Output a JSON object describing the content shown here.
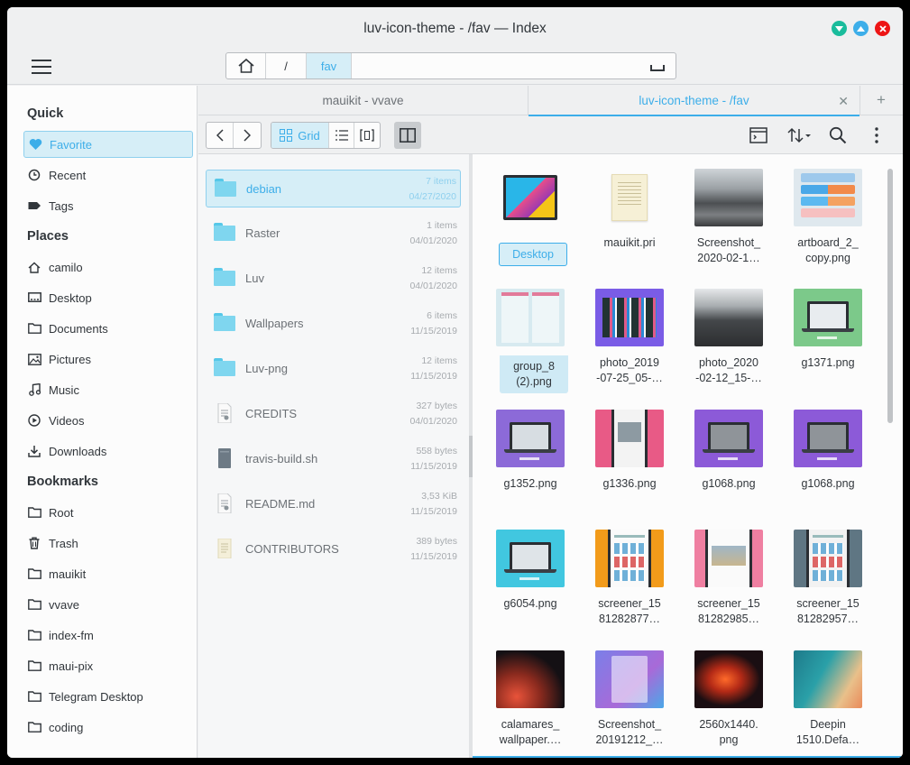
{
  "window": {
    "title": "luv-icon-theme - /fav — Index"
  },
  "pathbar": {
    "segments": [
      "/",
      "fav"
    ]
  },
  "sidebar": {
    "sections": [
      {
        "title": "Quick",
        "items": [
          {
            "label": "Favorite",
            "icon": "heart-icon",
            "active": true
          },
          {
            "label": "Recent",
            "icon": "history-icon"
          },
          {
            "label": "Tags",
            "icon": "tag-icon"
          }
        ]
      },
      {
        "title": "Places",
        "items": [
          {
            "label": "camilo",
            "icon": "home-icon"
          },
          {
            "label": "Desktop",
            "icon": "desktop-icon"
          },
          {
            "label": "Documents",
            "icon": "folder-icon"
          },
          {
            "label": "Pictures",
            "icon": "picture-icon"
          },
          {
            "label": "Music",
            "icon": "music-icon"
          },
          {
            "label": "Videos",
            "icon": "video-icon"
          },
          {
            "label": "Downloads",
            "icon": "download-icon"
          }
        ]
      },
      {
        "title": "Bookmarks",
        "items": [
          {
            "label": "Root",
            "icon": "folder-icon"
          },
          {
            "label": "Trash",
            "icon": "trash-icon"
          },
          {
            "label": "mauikit",
            "icon": "folder-icon"
          },
          {
            "label": "vvave",
            "icon": "folder-icon"
          },
          {
            "label": "index-fm",
            "icon": "folder-icon"
          },
          {
            "label": "maui-pix",
            "icon": "folder-icon"
          },
          {
            "label": "Telegram Desktop",
            "icon": "folder-icon"
          },
          {
            "label": "coding",
            "icon": "folder-icon"
          }
        ]
      }
    ]
  },
  "tabs": [
    {
      "label": "mauikit  -  vvave"
    },
    {
      "label": "luv-icon-theme  -  /fav",
      "active": true
    }
  ],
  "toolbar": {
    "grid_label": "Grid"
  },
  "list": [
    {
      "name": "debian",
      "meta": "7 items",
      "date": "04/27/2020",
      "type": "folder",
      "selected": true
    },
    {
      "name": "Raster",
      "meta": "1 items",
      "date": "04/01/2020",
      "type": "folder"
    },
    {
      "name": "Luv",
      "meta": "12 items",
      "date": "04/01/2020",
      "type": "folder"
    },
    {
      "name": "Wallpapers",
      "meta": "6 items",
      "date": "11/15/2019",
      "type": "folder"
    },
    {
      "name": "Luv-png",
      "meta": "12 items",
      "date": "11/15/2019",
      "type": "folder"
    },
    {
      "name": "CREDITS",
      "meta": "327 bytes",
      "date": "04/01/2020",
      "type": "text"
    },
    {
      "name": "travis-build.sh",
      "meta": "558 bytes",
      "date": "11/15/2019",
      "type": "script"
    },
    {
      "name": "README.md",
      "meta": "3,53 KiB",
      "date": "11/15/2019",
      "type": "text"
    },
    {
      "name": "CONTRIBUTORS",
      "meta": "389 bytes",
      "date": "11/15/2019",
      "type": "doc"
    }
  ],
  "grid": [
    {
      "label": "Desktop",
      "kind": "desktop",
      "style": "box"
    },
    {
      "label": "mauikit.pri",
      "kind": "doc"
    },
    {
      "label": "Screenshot_\n2020-02-1…",
      "kind": "photo-building"
    },
    {
      "label": "artboard_2_\ncopy.png",
      "kind": "app-ui"
    },
    {
      "label": "group_8\n(2).png",
      "kind": "mock-light",
      "style": "block"
    },
    {
      "label": "photo_2019\n-07-25_05-…",
      "kind": "purple-screen"
    },
    {
      "label": "photo_2020\n-02-12_15-…",
      "kind": "photo-river"
    },
    {
      "label": "g1371.png",
      "kind": "green-laptop"
    },
    {
      "label": "g1352.png",
      "kind": "purple-laptop"
    },
    {
      "label": "g1336.png",
      "kind": "pink-phone"
    },
    {
      "label": "g1068.png",
      "kind": "purple-dark-laptop"
    },
    {
      "label": "g1068.png",
      "kind": "purple-dark-laptop"
    },
    {
      "label": "g6054.png",
      "kind": "cyan-laptop"
    },
    {
      "label": "screener_15\n81282877…",
      "kind": "orange-phone"
    },
    {
      "label": "screener_15\n81282985…",
      "kind": "pink-phone2"
    },
    {
      "label": "screener_15\n81282957…",
      "kind": "slate-phone"
    },
    {
      "label": "calamares_\nwallpaper.…",
      "kind": "canyon"
    },
    {
      "label": "Screenshot_\n20191212_…",
      "kind": "gradient-login"
    },
    {
      "label": "2560x1440.\npng",
      "kind": "canyon2"
    },
    {
      "label": "Deepin\n1510.Defa…",
      "kind": "teal-orange"
    }
  ],
  "colors": {
    "accent": "#3daee9",
    "accent_bg": "#d6eef7",
    "folder": "#7fd6ef"
  }
}
